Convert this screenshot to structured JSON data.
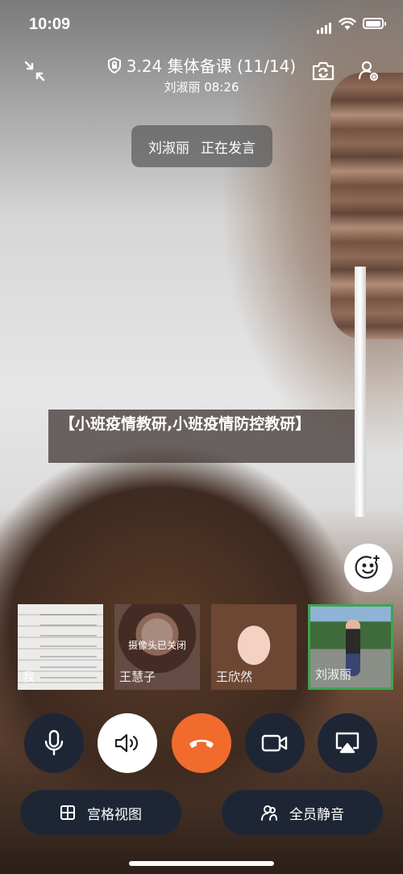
{
  "status_bar": {
    "time": "10:09"
  },
  "header": {
    "title": "3.24 集体备课 (11/14)",
    "subtitle": "刘淑丽 08:26",
    "icons": [
      "minimize-icon",
      "lock-icon",
      "camera-flip-icon",
      "user-settings-icon"
    ]
  },
  "speaker_toast": {
    "name": "刘淑丽",
    "status": "正在发言"
  },
  "caption": {
    "text": "【小班疫情教研,小班疫情防控教研】"
  },
  "participants": [
    {
      "name": "我",
      "camera_off_label": ""
    },
    {
      "name": "王慧子",
      "camera_off_label": "摄像头已关闭"
    },
    {
      "name": "王欣然",
      "camera_off_label": ""
    },
    {
      "name": "刘淑丽",
      "camera_off_label": "",
      "active": true
    }
  ],
  "controls": {
    "buttons": [
      "microphone-icon",
      "speaker-icon",
      "hang-up-icon",
      "video-camera-icon",
      "screen-share-icon"
    ]
  },
  "bottom_bar": {
    "grid_view_label": "宫格视图",
    "mute_all_label": "全员静音"
  },
  "colors": {
    "control_dark": "#1e2635",
    "hang_up": "#f06b2c",
    "active_border": "#3fa34d"
  }
}
